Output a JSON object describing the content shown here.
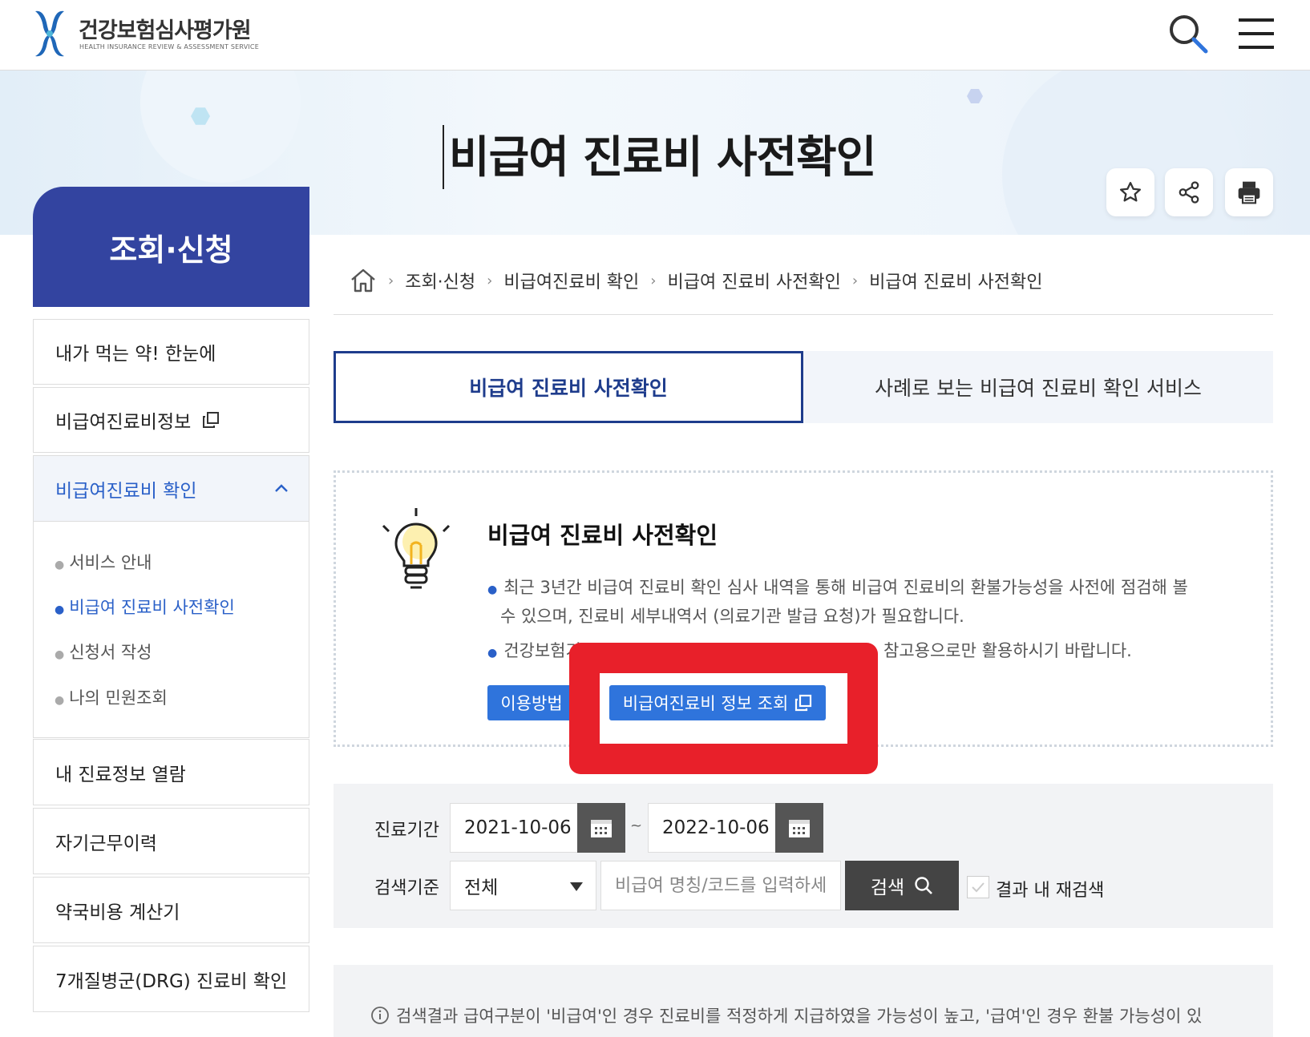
{
  "header": {
    "org_name": "건강보험심사평가원",
    "org_name_en": "HEALTH INSURANCE REVIEW & ASSESSMENT SERVICE",
    "search_icon": "search-icon",
    "menu_icon": "hamburger-menu-icon"
  },
  "banner": {
    "title": "비급여 진료비 사전확인",
    "utility_icons": [
      "star-icon",
      "share-icon",
      "print-icon"
    ]
  },
  "sidebar": {
    "heading": "조회·신청",
    "items": [
      {
        "label": "내가 먹는 약! 한눈에"
      },
      {
        "label": "비급여진료비정보"
      },
      {
        "label": "비급여진료비 확인"
      },
      {
        "label": "내 진료정보 열람"
      },
      {
        "label": "자기근무이력"
      },
      {
        "label": "약국비용 계산기"
      },
      {
        "label": "7개질병군(DRG) 진료비 확인"
      }
    ],
    "sub_items": [
      {
        "label": "서비스 안내"
      },
      {
        "label": "비급여 진료비 사전확인"
      },
      {
        "label": "신청서 작성"
      },
      {
        "label": "나의 민원조회"
      }
    ]
  },
  "breadcrumb": [
    "조회·신청",
    "비급여진료비 확인",
    "비급여 진료비 사전확인",
    "비급여 진료비 사전확인"
  ],
  "tabs": [
    {
      "label": "비급여 진료비 사전확인"
    },
    {
      "label": "사례로 보는 비급여 진료비 확인 서비스"
    }
  ],
  "info": {
    "title": "비급여 진료비 사전확인",
    "line1": "최근 3년간 비급여 진료비 확인 심사 내역을 통해 비급여 진료비의 환불가능성을 사전에 점검해 볼",
    "line2": "수 있으며, 진료비 세부내역서 (의료기관 발급 요청)가 필요합니다.",
    "line3_start": "건강보험기",
    "line3_end": "참고용으로만 활용하시기 바랍니다.",
    "btn_usage": "이용방법",
    "btn_lookup": "비급여진료비 정보 조회"
  },
  "search": {
    "period_label": "진료기간",
    "date_from": "2021-10-06",
    "date_to": "2022-10-06",
    "tilde": "~",
    "criteria_label": "검색기준",
    "criteria_value": "전체",
    "keyword_placeholder": "비급여 명칭/코드를 입력하세",
    "search_btn": "검색",
    "recheck_label": "결과 내 재검색"
  },
  "notice": {
    "text": "검색결과 급여구분이 '비급여'인 경우 진료비를 적정하게 지급하였을 가능성이 높고, '급여'인 경우 환불 가능성이 있"
  },
  "colors": {
    "primary_navy": "#3344a0",
    "accent_blue": "#2f74dc",
    "annotation_red": "#e8202a"
  }
}
